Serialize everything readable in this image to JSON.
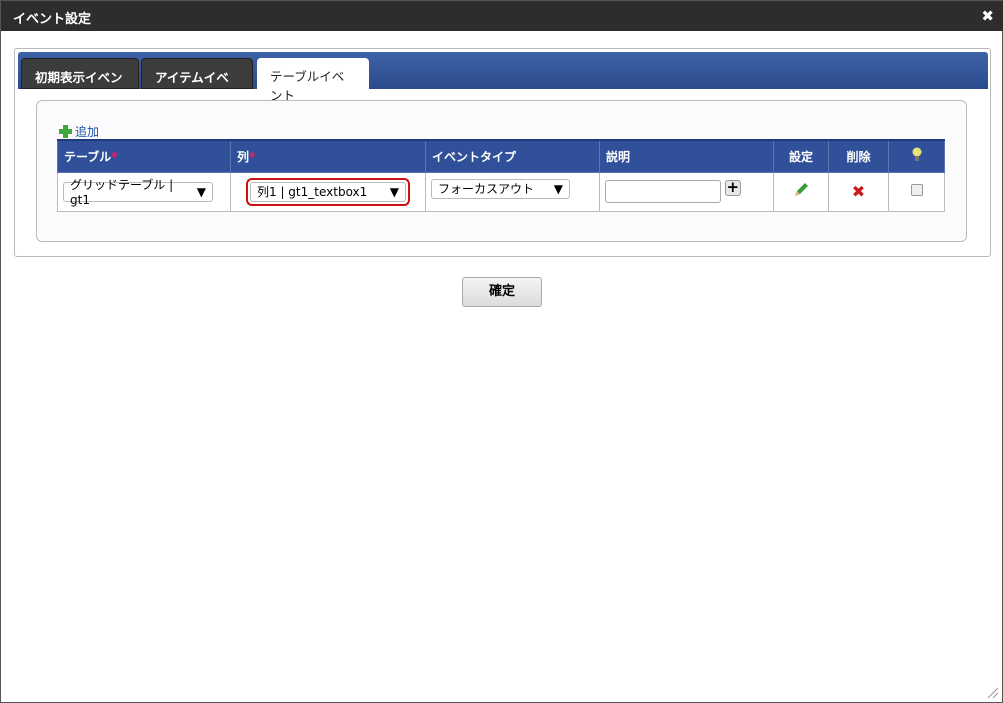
{
  "dialog": {
    "title": "イベント設定",
    "close": "✖"
  },
  "tabs": [
    {
      "label": "初期表示イベント"
    },
    {
      "label": "アイテムイベント"
    },
    {
      "label": "テーブルイベント"
    }
  ],
  "add_label": "追加",
  "columns": [
    "テーブル",
    "列",
    "イベントタイプ",
    "説明",
    "設定",
    "削除"
  ],
  "required_mark": "*",
  "row": {
    "table": "グリッドテーブル | gt1",
    "column": "列1 | gt1_textbox1",
    "event_type": "フォーカスアウト",
    "description": ""
  },
  "confirm_label": "確定"
}
